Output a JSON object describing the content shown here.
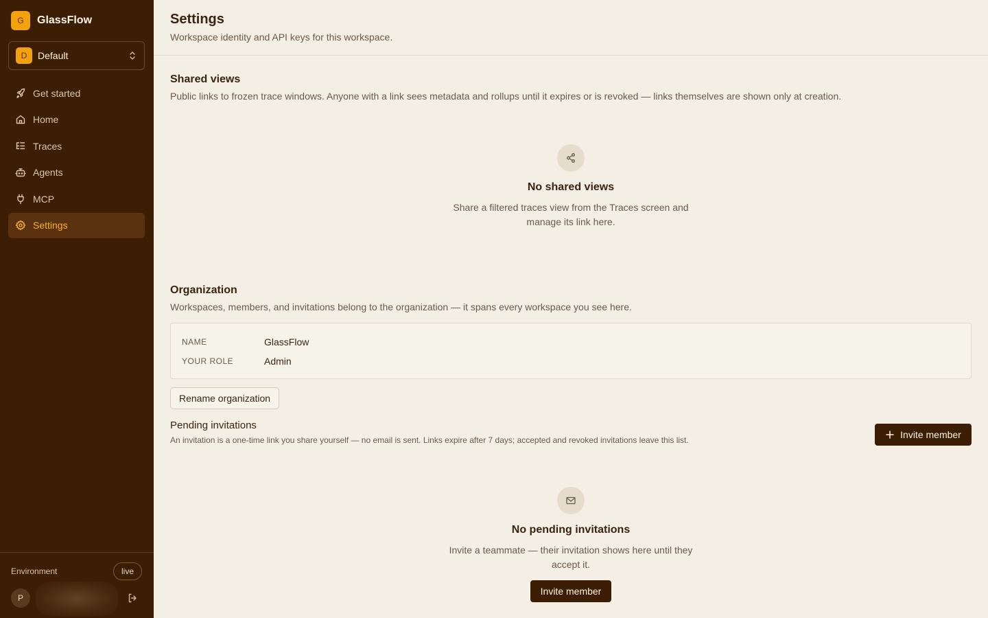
{
  "brand": {
    "logo_letter": "G",
    "name": "GlassFlow"
  },
  "workspace": {
    "badge": "D",
    "name": "Default"
  },
  "nav": [
    {
      "label": "Get started",
      "icon": "rocket-icon",
      "active": false
    },
    {
      "label": "Home",
      "icon": "home-icon",
      "active": false
    },
    {
      "label": "Traces",
      "icon": "list-tree-icon",
      "active": false
    },
    {
      "label": "Agents",
      "icon": "bot-icon",
      "active": false
    },
    {
      "label": "MCP",
      "icon": "plug-icon",
      "active": false
    },
    {
      "label": "Settings",
      "icon": "gear-icon",
      "active": true
    }
  ],
  "footer": {
    "env_label": "Environment",
    "env_value": "live",
    "user_initial": "P"
  },
  "header": {
    "title": "Settings",
    "subtitle": "Workspace identity and API keys for this workspace."
  },
  "shared_views": {
    "title": "Shared views",
    "description": "Public links to frozen trace windows. Anyone with a link sees metadata and rollups until it expires or is revoked — links themselves are shown only at creation.",
    "empty_icon": "share-icon",
    "empty_title": "No shared views",
    "empty_desc": "Share a filtered traces view from the Traces screen and manage its link here."
  },
  "organization": {
    "title": "Organization",
    "description": "Workspaces, members, and invitations belong to the organization — it spans every workspace you see here.",
    "name_key": "NAME",
    "name_value": "GlassFlow",
    "role_key": "YOUR ROLE",
    "role_value": "Admin",
    "rename_label": "Rename organization"
  },
  "invitations": {
    "title": "Pending invitations",
    "description": "An invitation is a one-time link you share yourself — no email is sent. Links expire after 7 days; accepted and revoked invitations leave this list.",
    "invite_label": "Invite member",
    "empty_icon": "mail-icon",
    "empty_title": "No pending invitations",
    "empty_desc": "Invite a teammate — their invitation shows here until they accept it.",
    "empty_button": "Invite member"
  },
  "colors": {
    "sidebar": "#3c1e05",
    "accent": "#f2a20c",
    "background": "#f3efe4"
  }
}
